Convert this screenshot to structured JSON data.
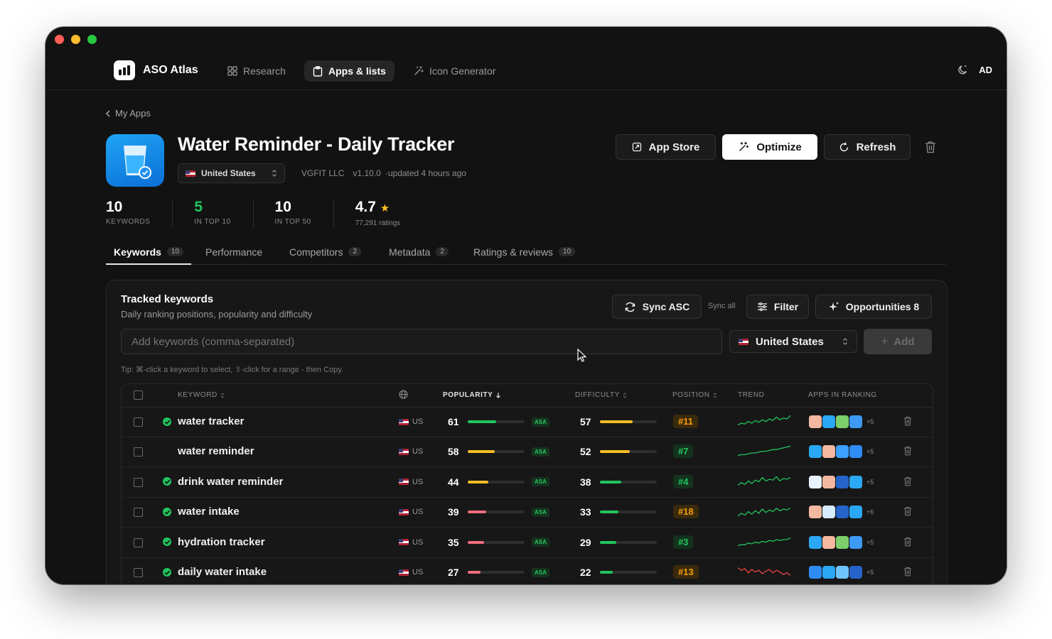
{
  "brand": {
    "name": "ASO Atlas"
  },
  "nav": [
    {
      "label": "Research",
      "icon": "grid-icon"
    },
    {
      "label": "Apps & lists",
      "icon": "clipboard-icon"
    },
    {
      "label": "Icon Generator",
      "icon": "wand-icon"
    }
  ],
  "user": {
    "initials": "AD"
  },
  "breadcrumb": {
    "back_label": "My Apps"
  },
  "app": {
    "title": "Water Reminder - Daily Tracker",
    "country": "United States",
    "developer": "VGFIT LLC",
    "version": "v1.10.0",
    "updated": "·updated 4 hours ago"
  },
  "actions": {
    "app_store": "App Store",
    "optimize": "Optimize",
    "refresh": "Refresh"
  },
  "stats": [
    {
      "value": "10",
      "label": "KEYWORDS",
      "color": "#ffffff"
    },
    {
      "value": "5",
      "label": "IN TOP 10",
      "color": "#22c55e"
    },
    {
      "value": "10",
      "label": "IN TOP 50",
      "color": "#ffffff"
    },
    {
      "value": "4.7",
      "label": "77,291 ratings",
      "color": "#ffffff",
      "star": true
    }
  ],
  "tabs": [
    {
      "label": "Keywords",
      "count": "10"
    },
    {
      "label": "Performance",
      "count": ""
    },
    {
      "label": "Competitors",
      "count": "2"
    },
    {
      "label": "Metadata",
      "count": "2"
    },
    {
      "label": "Ratings & reviews",
      "count": "10"
    }
  ],
  "tracked": {
    "title": "Tracked keywords",
    "subtitle": "Daily ranking positions, popularity and difficulty",
    "sync_asc": "Sync ASC",
    "sync_all": "Sync all",
    "filter": "Filter",
    "opportunities": "Opportunities 8",
    "input_placeholder": "Add keywords (comma-separated)",
    "country": "United States",
    "add": "Add",
    "tip": "Tip: ⌘-click a keyword to select, ⇧-click for a range - then Copy."
  },
  "table": {
    "headers": {
      "keyword": "KEYWORD",
      "popularity": "POPULARITY",
      "difficulty": "DIFFICULTY",
      "position": "POSITION",
      "trend": "TREND",
      "apps": "APPS IN RANKING"
    },
    "rows": [
      {
        "keyword": "water tracker",
        "verified": true,
        "country": "US",
        "popularity": 61,
        "difficulty": 57,
        "position": "#11",
        "trend_color": "#22c55e",
        "apps_more": "+5",
        "trend": [
          3,
          5,
          4,
          7,
          5,
          8,
          6,
          9,
          7,
          10,
          8,
          12,
          9,
          11,
          10,
          14
        ]
      },
      {
        "keyword": "water reminder",
        "verified": false,
        "country": "US",
        "popularity": 58,
        "difficulty": 52,
        "position": "#7",
        "trend_color": "#22c55e",
        "apps_more": "+5",
        "trend": [
          2,
          3,
          3,
          4,
          5,
          5,
          6,
          7,
          7,
          8,
          9,
          9,
          10,
          11,
          12,
          13
        ]
      },
      {
        "keyword": "drink water reminder",
        "verified": true,
        "country": "US",
        "popularity": 44,
        "difficulty": 38,
        "position": "#4",
        "trend_color": "#22c55e",
        "apps_more": "+5",
        "trend": [
          3,
          6,
          4,
          8,
          5,
          9,
          7,
          12,
          8,
          10,
          9,
          13,
          8,
          11,
          10,
          12
        ]
      },
      {
        "keyword": "water intake",
        "verified": true,
        "country": "US",
        "popularity": 39,
        "difficulty": 33,
        "position": "#18",
        "trend_color": "#22c55e",
        "apps_more": "+6",
        "trend": [
          2,
          5,
          3,
          7,
          4,
          8,
          5,
          10,
          6,
          9,
          7,
          11,
          8,
          10,
          9,
          11
        ]
      },
      {
        "keyword": "hydration tracker",
        "verified": true,
        "country": "US",
        "popularity": 35,
        "difficulty": 29,
        "position": "#3",
        "trend_color": "#22c55e",
        "apps_more": "+5",
        "trend": [
          3,
          4,
          4,
          6,
          5,
          7,
          6,
          8,
          7,
          9,
          8,
          10,
          9,
          10,
          10,
          12
        ]
      },
      {
        "keyword": "daily water intake",
        "verified": true,
        "country": "US",
        "popularity": 27,
        "difficulty": 22,
        "position": "#13",
        "trend_color": "#ef4444",
        "apps_more": "+5",
        "trend": [
          12,
          9,
          11,
          6,
          10,
          7,
          9,
          5,
          8,
          10,
          6,
          9,
          7,
          4,
          6,
          3
        ]
      }
    ]
  },
  "colors": {
    "green": "#22c55e",
    "amber": "#fbbf24",
    "red": "#f26d7d",
    "pos_amber": "#f59e0b",
    "pos_green": "#22c55e"
  }
}
